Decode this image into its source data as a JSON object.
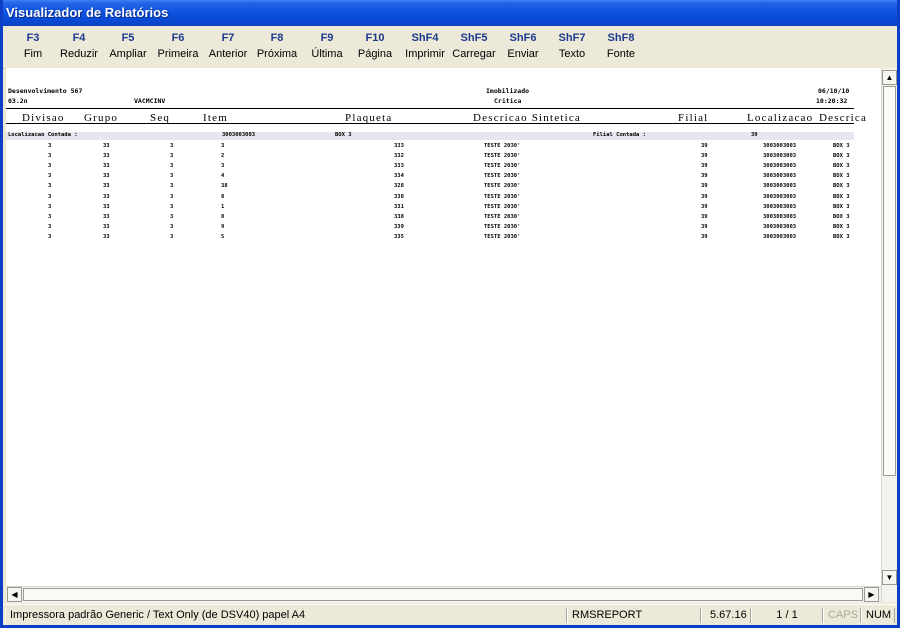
{
  "window": {
    "title": "Visualizador de Relatórios"
  },
  "toolbar": [
    {
      "key": "F3",
      "label": "Fim"
    },
    {
      "key": "F4",
      "label": "Reduzir"
    },
    {
      "key": "F5",
      "label": "Ampliar"
    },
    {
      "key": "F6",
      "label": "Primeira"
    },
    {
      "key": "F7",
      "label": "Anterior"
    },
    {
      "key": "F8",
      "label": "Próxima"
    },
    {
      "key": "F9",
      "label": "Última"
    },
    {
      "key": "F10",
      "label": "Página"
    },
    {
      "key": "ShF4",
      "label": "Imprimir"
    },
    {
      "key": "ShF5",
      "label": "Carregar"
    },
    {
      "key": "ShF6",
      "label": "Enviar"
    },
    {
      "key": "ShF7",
      "label": "Texto"
    },
    {
      "key": "ShF8",
      "label": "Fonte"
    }
  ],
  "report": {
    "header_left_1": "Desenvolvimento 567",
    "header_left_2": "03.2n",
    "header_program": "VACMCINV",
    "header_center_1": "Imobilizado",
    "header_center_2": "Critica",
    "date": "06/10/10",
    "time": "10:20:32",
    "columns": {
      "divisao": "Divisao",
      "grupo": "Grupo",
      "seq": "Seq",
      "item": "Item",
      "plaqueta": "Plaqueta",
      "descricao": "Descricao Sintetica",
      "filial": "Filial",
      "localizacao": "Localizacao",
      "descricao2": "Descrica"
    },
    "group": {
      "loc_label": "Localizacao Contada :",
      "loc_value": "3003003003",
      "box": "BOX 3",
      "filial_label": "Filial Contada :",
      "filial_value": "39"
    },
    "rows": [
      {
        "divisao": "3",
        "grupo": "33",
        "seq": "3",
        "item": "3",
        "plaqueta": "333",
        "descricao": "TESTE 2030'",
        "filial": "39",
        "localizacao": "3003003003",
        "desc2": "BOX 3"
      },
      {
        "divisao": "3",
        "grupo": "33",
        "seq": "3",
        "item": "2",
        "plaqueta": "332",
        "descricao": "TESTE 2030'",
        "filial": "39",
        "localizacao": "3003003003",
        "desc2": "BOX 3"
      },
      {
        "divisao": "3",
        "grupo": "33",
        "seq": "3",
        "item": "3",
        "plaqueta": "333",
        "descricao": "TESTE 2030'",
        "filial": "39",
        "localizacao": "3003003003",
        "desc2": "BOX 3"
      },
      {
        "divisao": "3",
        "grupo": "33",
        "seq": "3",
        "item": "4",
        "plaqueta": "334",
        "descricao": "TESTE 2030'",
        "filial": "39",
        "localizacao": "3003003003",
        "desc2": "BOX 3"
      },
      {
        "divisao": "3",
        "grupo": "33",
        "seq": "3",
        "item": "38",
        "plaqueta": "328",
        "descricao": "TESTE 2030'",
        "filial": "39",
        "localizacao": "3003003003",
        "desc2": "BOX 3"
      },
      {
        "divisao": "3",
        "grupo": "33",
        "seq": "3",
        "item": "8",
        "plaqueta": "338",
        "descricao": "TESTE 2030'",
        "filial": "39",
        "localizacao": "3003003003",
        "desc2": "BOX 3"
      },
      {
        "divisao": "3",
        "grupo": "33",
        "seq": "3",
        "item": "1",
        "plaqueta": "331",
        "descricao": "TESTE 2030'",
        "filial": "39",
        "localizacao": "3003003003",
        "desc2": "BOX 3"
      },
      {
        "divisao": "3",
        "grupo": "33",
        "seq": "3",
        "item": "8",
        "plaqueta": "338",
        "descricao": "TESTE 2030'",
        "filial": "39",
        "localizacao": "3003003003",
        "desc2": "BOX 3"
      },
      {
        "divisao": "3",
        "grupo": "33",
        "seq": "3",
        "item": "9",
        "plaqueta": "339",
        "descricao": "TESTE 2030'",
        "filial": "39",
        "localizacao": "3003003003",
        "desc2": "BOX 3"
      },
      {
        "divisao": "3",
        "grupo": "33",
        "seq": "3",
        "item": "5",
        "plaqueta": "335",
        "descricao": "TESTE 2030'",
        "filial": "39",
        "localizacao": "3003003003",
        "desc2": "BOX 3"
      }
    ]
  },
  "statusbar": {
    "printer": "Impressora padrão Generic / Text Only (de DSV40) papel A4",
    "app": "RMSREPORT",
    "version": "5.67.16",
    "page": "1 / 1",
    "caps": "CAPS",
    "num": "NUM"
  },
  "icons": {
    "scroll_up": "scroll-up-arrow-icon",
    "scroll_down": "scroll-down-arrow-icon",
    "scroll_left": "scroll-left-arrow-icon",
    "scroll_right": "scroll-right-arrow-icon"
  }
}
